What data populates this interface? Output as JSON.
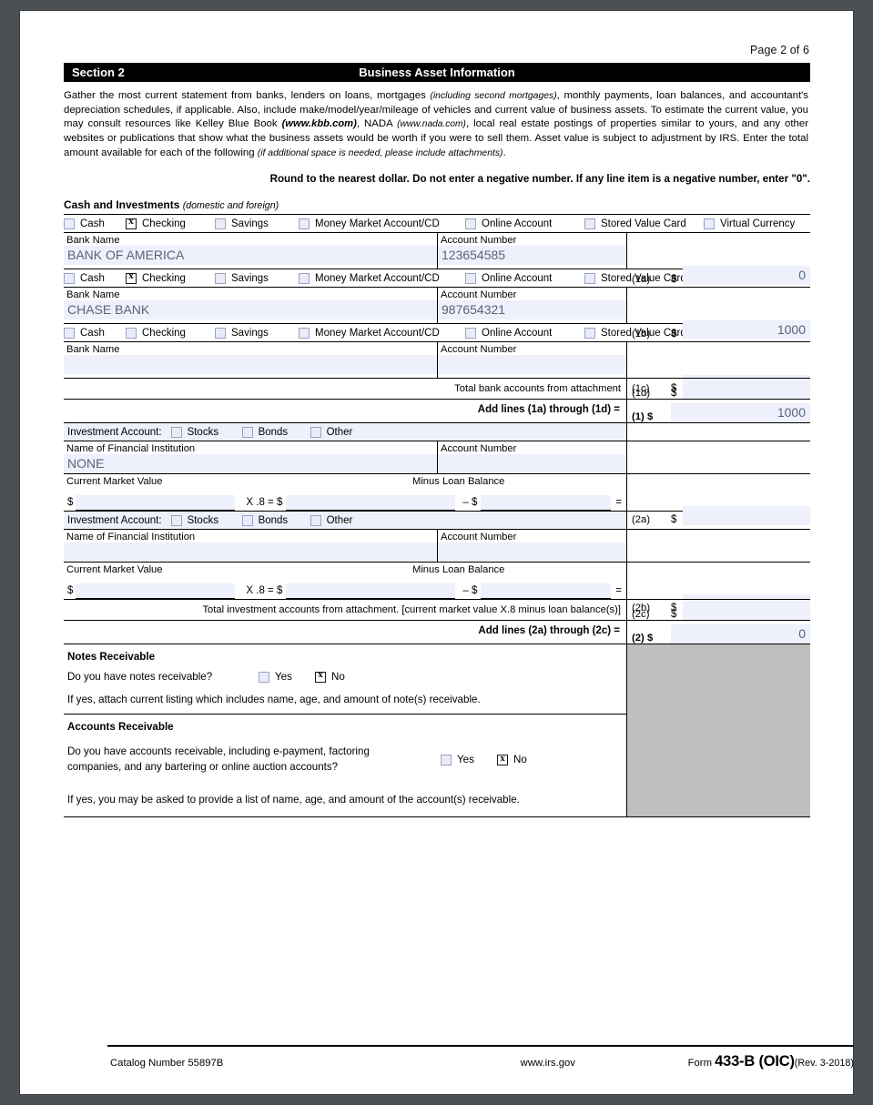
{
  "page": {
    "page_number_label": "Page 2 of 6",
    "section_label": "Section 2",
    "section_title": "Business Asset Information"
  },
  "intro": {
    "part1": "Gather the most current statement from banks, lenders on loans, mortgages ",
    "italic1": "(including second mortgages)",
    "part2": ", monthly payments, loan balances, and accountant's depreciation schedules, if applicable. Also, include make/model/year/mileage of vehicles and current value of business assets. To  estimate the current value, you may consult resources like Kelley Blue Book  ",
    "link1": "(www.kbb.com)",
    "part3": ", NADA ",
    "link2": "(www.nada.com)",
    "part4": ", local real estate postings of  properties similar to yours, and any other websites or publications that show what the business assets would be worth if you were to sell them. Asset  value is subject to adjustment by IRS. Enter the total amount available for each of the following ",
    "italic2": "(if additional space is needed, please include attachments)",
    "part5": ".",
    "round_note": "Round to the nearest dollar. Do not enter a negative number. If any line item is a negative number, enter \"0\"."
  },
  "cash_and_investments": {
    "heading": "Cash and Investments",
    "heading_note": "(domestic and foreign)",
    "bank_rows": [
      {
        "checkboxes": [
          {
            "label": "Cash",
            "checked": false
          },
          {
            "label": "Checking",
            "checked": true
          },
          {
            "label": "Savings",
            "checked": false
          },
          {
            "label": "Money Market Account/CD",
            "checked": false
          },
          {
            "label": "Online Account",
            "checked": false
          },
          {
            "label": "Stored Value Card",
            "checked": false
          },
          {
            "label": "Virtual Currency",
            "checked": false
          }
        ],
        "bank_name_label": "Bank Name",
        "bank_name_value": "BANK OF AMERICA",
        "account_number_label": "Account Number",
        "account_number_value": "123654585",
        "amount_line": "(1a)",
        "amount_value": "0"
      },
      {
        "checkboxes": [
          {
            "label": "Cash",
            "checked": false
          },
          {
            "label": "Checking",
            "checked": true
          },
          {
            "label": "Savings",
            "checked": false
          },
          {
            "label": "Money Market Account/CD",
            "checked": false
          },
          {
            "label": "Online Account",
            "checked": false
          },
          {
            "label": "Stored Value Card",
            "checked": false
          }
        ],
        "bank_name_label": "Bank Name",
        "bank_name_value": "CHASE BANK",
        "account_number_label": "Account Number",
        "account_number_value": "987654321",
        "amount_line": "(1b)",
        "amount_value": "1000"
      },
      {
        "checkboxes": [
          {
            "label": "Cash",
            "checked": false
          },
          {
            "label": "Checking",
            "checked": false
          },
          {
            "label": "Savings",
            "checked": false
          },
          {
            "label": "Money Market Account/CD",
            "checked": false
          },
          {
            "label": "Online Account",
            "checked": false
          },
          {
            "label": "Stored Value Card",
            "checked": false
          }
        ],
        "bank_name_label": "Bank Name",
        "bank_name_value": "",
        "account_number_label": "Account Number",
        "account_number_value": "",
        "amount_line": "(1c)",
        "amount_value": ""
      }
    ],
    "attachment_row": {
      "label": "Total bank accounts from attachment",
      "amount_line": "(1d)",
      "amount_value": ""
    },
    "total_row": {
      "label": "Add lines (1a) through (1d) =",
      "amount_line": "(1) $",
      "amount_value": "1000"
    },
    "investment_rows": [
      {
        "type_label": "Investment Account:",
        "checkboxes": [
          {
            "label": "Stocks",
            "checked": false
          },
          {
            "label": "Bonds",
            "checked": false
          },
          {
            "label": "Other",
            "checked": false
          }
        ],
        "institution_label": "Name of Financial Institution",
        "institution_value": "NONE",
        "account_number_label": "Account Number",
        "account_number_value": "",
        "cmv_label": "Current Market Value",
        "cmv_value": "",
        "multiplier_label": "X .8 = $",
        "multiplier_value": "",
        "minus_label": "–  $",
        "loan_label": "Minus Loan Balance",
        "loan_value": "",
        "equals_label": "=",
        "amount_line": "(2a)",
        "amount_value": ""
      },
      {
        "type_label": "Investment Account:",
        "checkboxes": [
          {
            "label": "Stocks",
            "checked": false
          },
          {
            "label": "Bonds",
            "checked": false
          },
          {
            "label": "Other",
            "checked": false
          }
        ],
        "institution_label": "Name of Financial Institution",
        "institution_value": "",
        "account_number_label": "Account Number",
        "account_number_value": "",
        "cmv_label": "Current Market Value",
        "cmv_value": "",
        "multiplier_label": "X .8 = $",
        "multiplier_value": "",
        "minus_label": "–  $",
        "loan_label": "Minus Loan Balance",
        "loan_value": "",
        "equals_label": "=",
        "amount_line": "(2b)",
        "amount_value": ""
      }
    ],
    "investment_attachment_row": {
      "label": "Total investment accounts from attachment. [current market value X.8 minus loan balance(s)]",
      "amount_line": "(2c)",
      "amount_value": ""
    },
    "investment_total_row": {
      "label": "Add lines (2a) through (2c) =",
      "amount_line": "(2) $",
      "amount_value": "0"
    }
  },
  "notes_receivable": {
    "heading": "Notes Receivable",
    "question": "Do you have notes receivable?",
    "yes_label": "Yes",
    "yes_checked": false,
    "no_label": "No",
    "no_checked": true,
    "instruction": "If yes, attach current listing which includes name, age, and amount of note(s) receivable."
  },
  "accounts_receivable": {
    "heading": "Accounts Receivable",
    "question_line1": "Do you have accounts receivable, including e-payment, factoring",
    "question_line2": "companies, and any bartering or online auction accounts?",
    "yes_label": "Yes",
    "yes_checked": false,
    "no_label": "No",
    "no_checked": true,
    "instruction": "If yes, you may be asked to provide a list of name, age, and amount of the account(s) receivable."
  },
  "footer": {
    "catalog": "Catalog Number 55897B",
    "website": "www.irs.gov",
    "form_word": "Form",
    "form_number": "433-B (OIC)",
    "revision": "(Rev. 3-2018)"
  },
  "colors": {
    "field_fill": "#eef0fb",
    "checkbox_fill": "#e9ecf8",
    "gray_block": "#bfbfbf",
    "page_background": "#4b5055",
    "text": "#000000",
    "value_text": "#5a6478"
  }
}
